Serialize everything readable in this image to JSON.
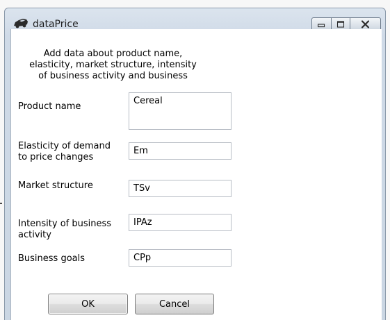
{
  "window": {
    "title": "dataPrice",
    "icon": "car-icon"
  },
  "dialog": {
    "instructions": "Add data about product name,\nelasticity, market structure, intensity\nof business activity and business",
    "fields": [
      {
        "label": "Product name",
        "value": "Cereal"
      },
      {
        "label": "Elasticity of demand\nto price changes",
        "value": "Em"
      },
      {
        "label": "Market structure",
        "value": "TSv"
      },
      {
        "label": "Intensity of business\nactivity",
        "value": "IPAz"
      },
      {
        "label": "Business goals",
        "value": "CPp"
      }
    ],
    "ok_label": "OK",
    "cancel_label": "Cancel"
  }
}
